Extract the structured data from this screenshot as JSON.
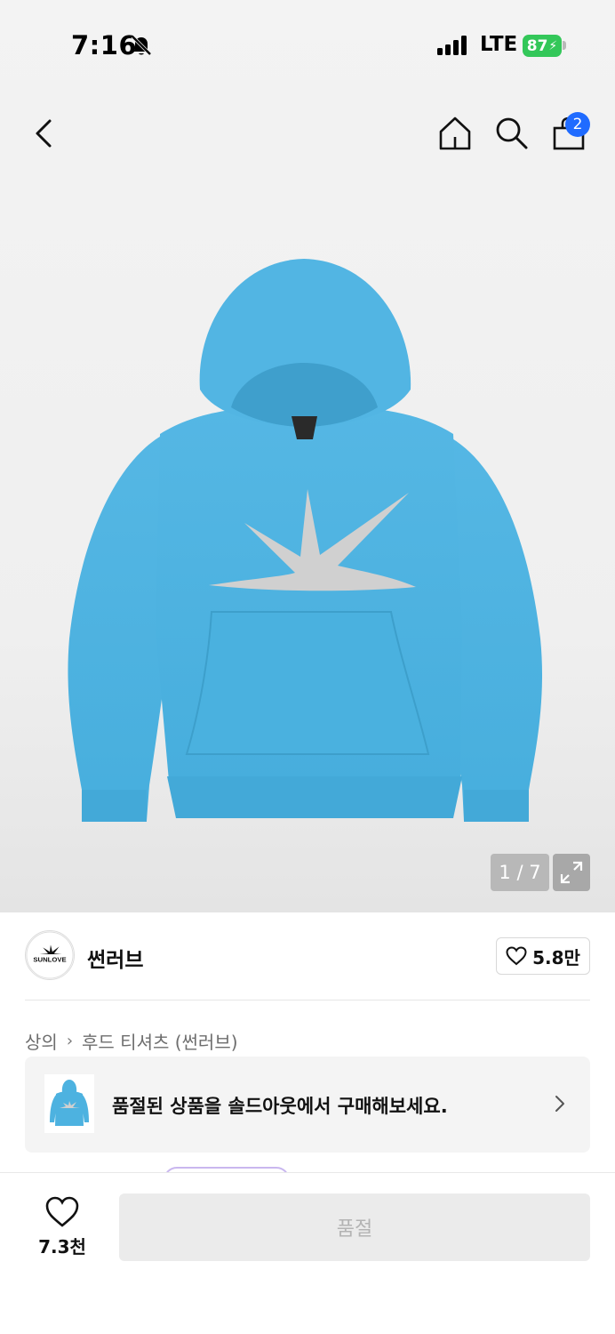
{
  "status_bar": {
    "time": "7:16",
    "network": "LTE",
    "battery": "87"
  },
  "nav": {
    "cart_badge": "2",
    "icons": [
      "back-icon",
      "home-icon",
      "search-icon",
      "shopping-bag-icon"
    ]
  },
  "product_image": {
    "counter": "1 / 7",
    "color": "#4db2e0"
  },
  "brand": {
    "logo_text": "SUNLOVE",
    "name": "썬러브",
    "likes": "5.8만"
  },
  "breadcrumb": {
    "category": "상의",
    "subcategory": "후드 티셔츠 (썬러브)"
  },
  "soldout_banner": {
    "text": "품절된 상품을 솔드아웃에서 구매해보세요."
  },
  "bottom_bar": {
    "wish_count": "7.3천",
    "buy_label": "품절"
  },
  "colors": {
    "accent_blue": "#1f6bff",
    "battery_green": "#33c759"
  }
}
